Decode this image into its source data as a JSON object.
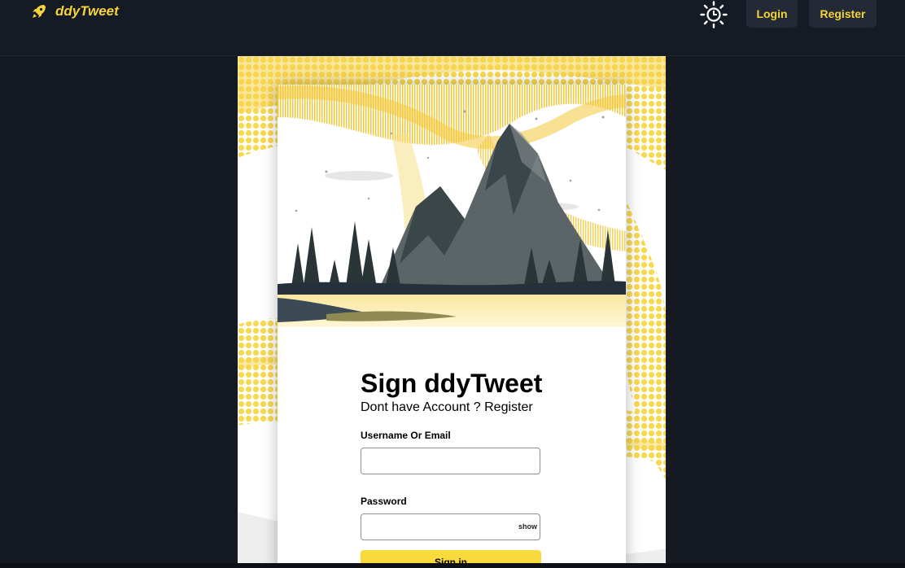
{
  "brand": {
    "name": "ddyTweet",
    "icon": "rocket-icon"
  },
  "nav": {
    "theme_icon": "sun-icon",
    "login_label": "Login",
    "register_label": "Register"
  },
  "form": {
    "title": "Sign ddyTweet",
    "subtitle_prefix": "Dont have Account ? ",
    "subtitle_link": "Register",
    "username_label": "Username Or Email",
    "username_value": "",
    "password_label": "Password",
    "password_value": "",
    "show_label": "show",
    "signin_label": "Sign in"
  },
  "colors": {
    "accent": "#f5d33a",
    "background": "#141922",
    "button": "#f8da3c"
  }
}
